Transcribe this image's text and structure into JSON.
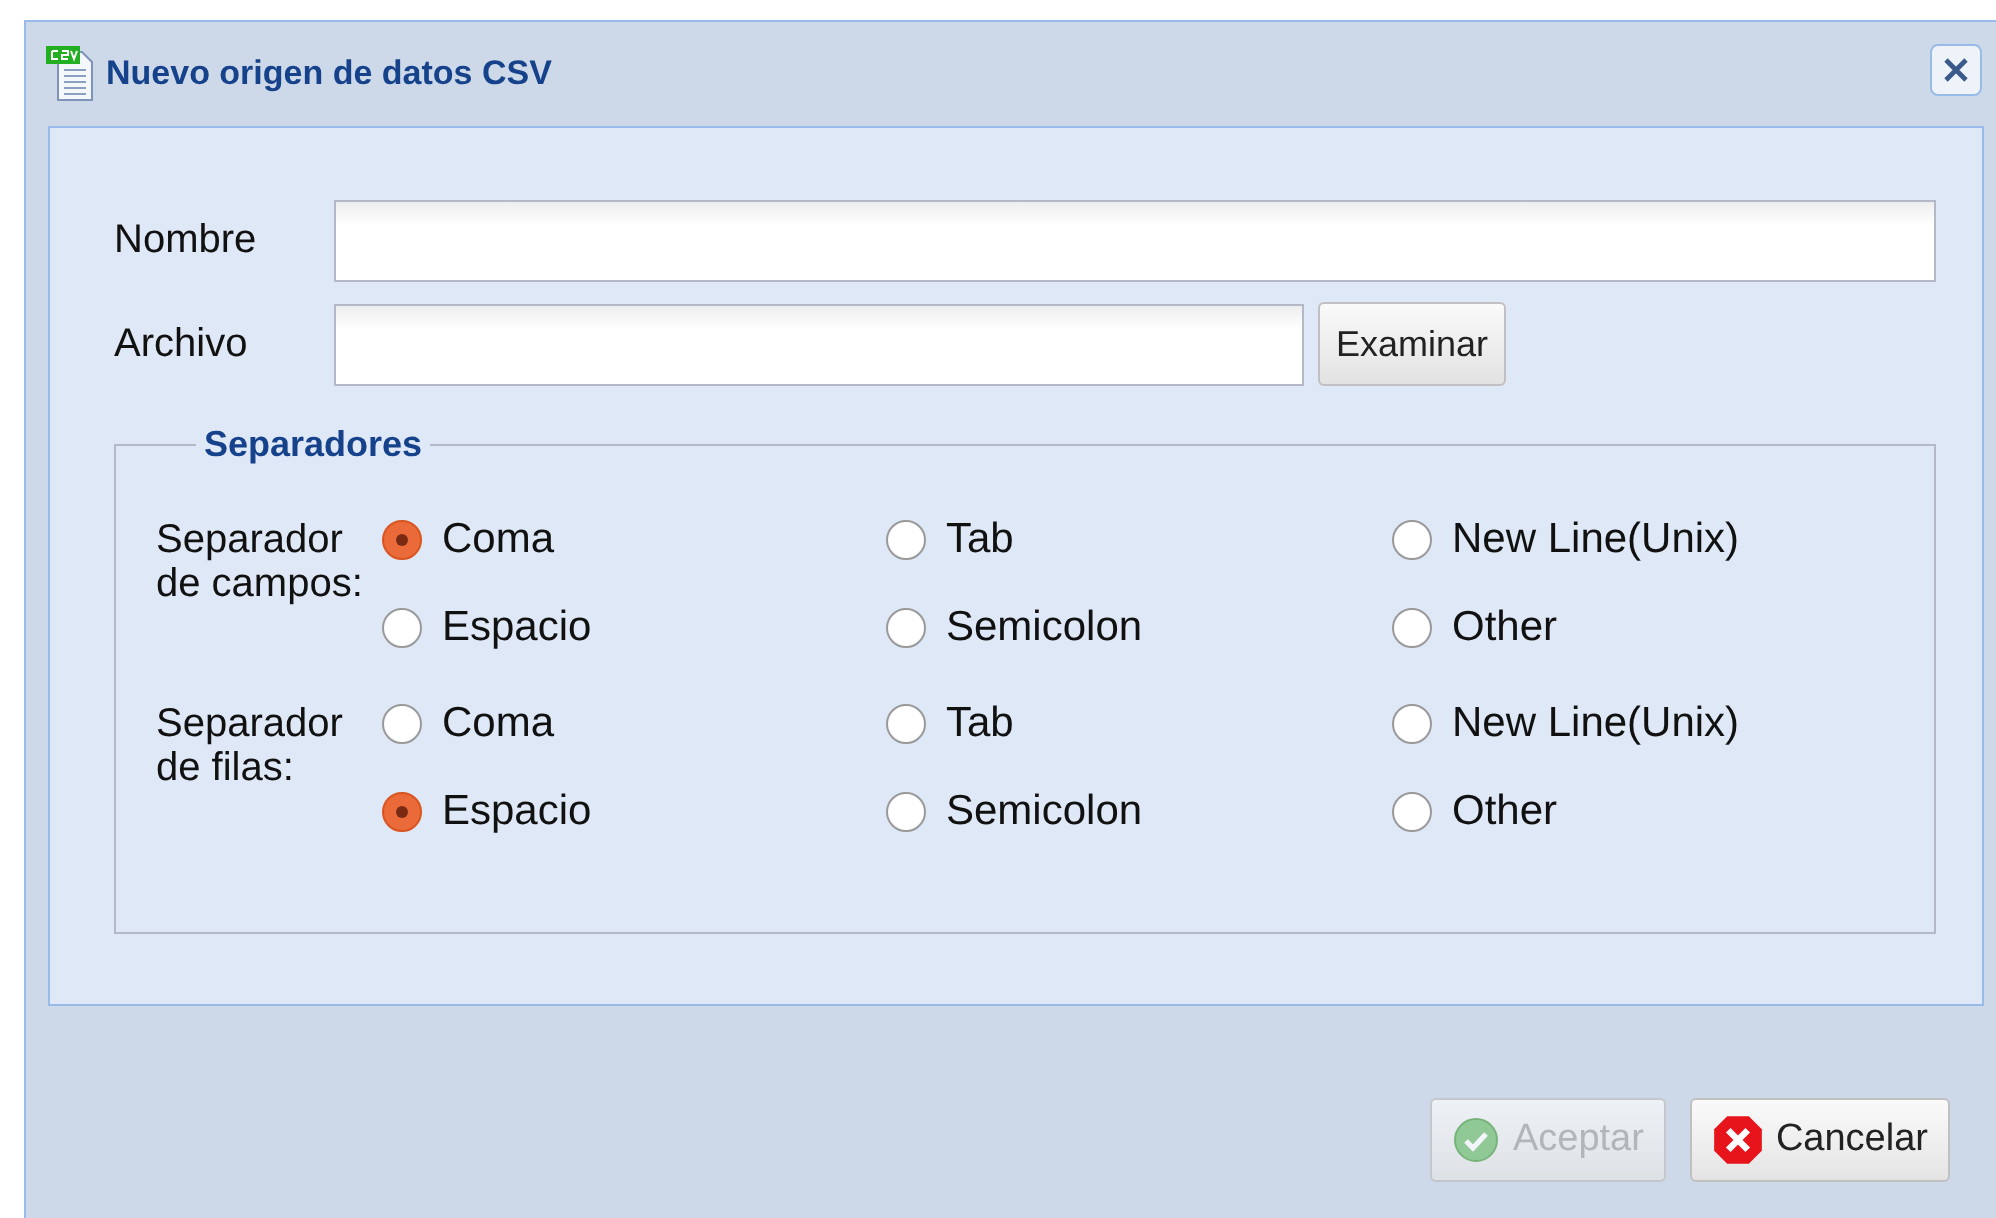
{
  "window": {
    "title": "Nuevo origen de datos CSV"
  },
  "fields": [
    {
      "label": "Nombre"
    },
    {
      "label": "Archivo",
      "button": "Examinar"
    }
  ],
  "separators": {
    "legend": "Separadores",
    "groups": [
      {
        "label": "Separador de campos:",
        "options": [
          {
            "label": "Coma",
            "selected": true
          },
          {
            "label": "Tab",
            "selected": false
          },
          {
            "label": "New Line(Unix)",
            "selected": false
          },
          {
            "label": "Espacio",
            "selected": false
          },
          {
            "label": "Semicolon",
            "selected": false
          },
          {
            "label": "Other",
            "selected": false
          }
        ]
      },
      {
        "label": "Separador de filas:",
        "options": [
          {
            "label": "Coma",
            "selected": false
          },
          {
            "label": "Tab",
            "selected": false
          },
          {
            "label": "New Line(Unix)",
            "selected": false
          },
          {
            "label": "Espacio",
            "selected": true
          },
          {
            "label": "Semicolon",
            "selected": false
          },
          {
            "label": "Other",
            "selected": false
          }
        ]
      }
    ]
  },
  "buttons": [
    {
      "label": "Aceptar",
      "kind": "ok",
      "disabled": true
    },
    {
      "label": "Cancelar",
      "kind": "cancel",
      "disabled": false
    }
  ]
}
